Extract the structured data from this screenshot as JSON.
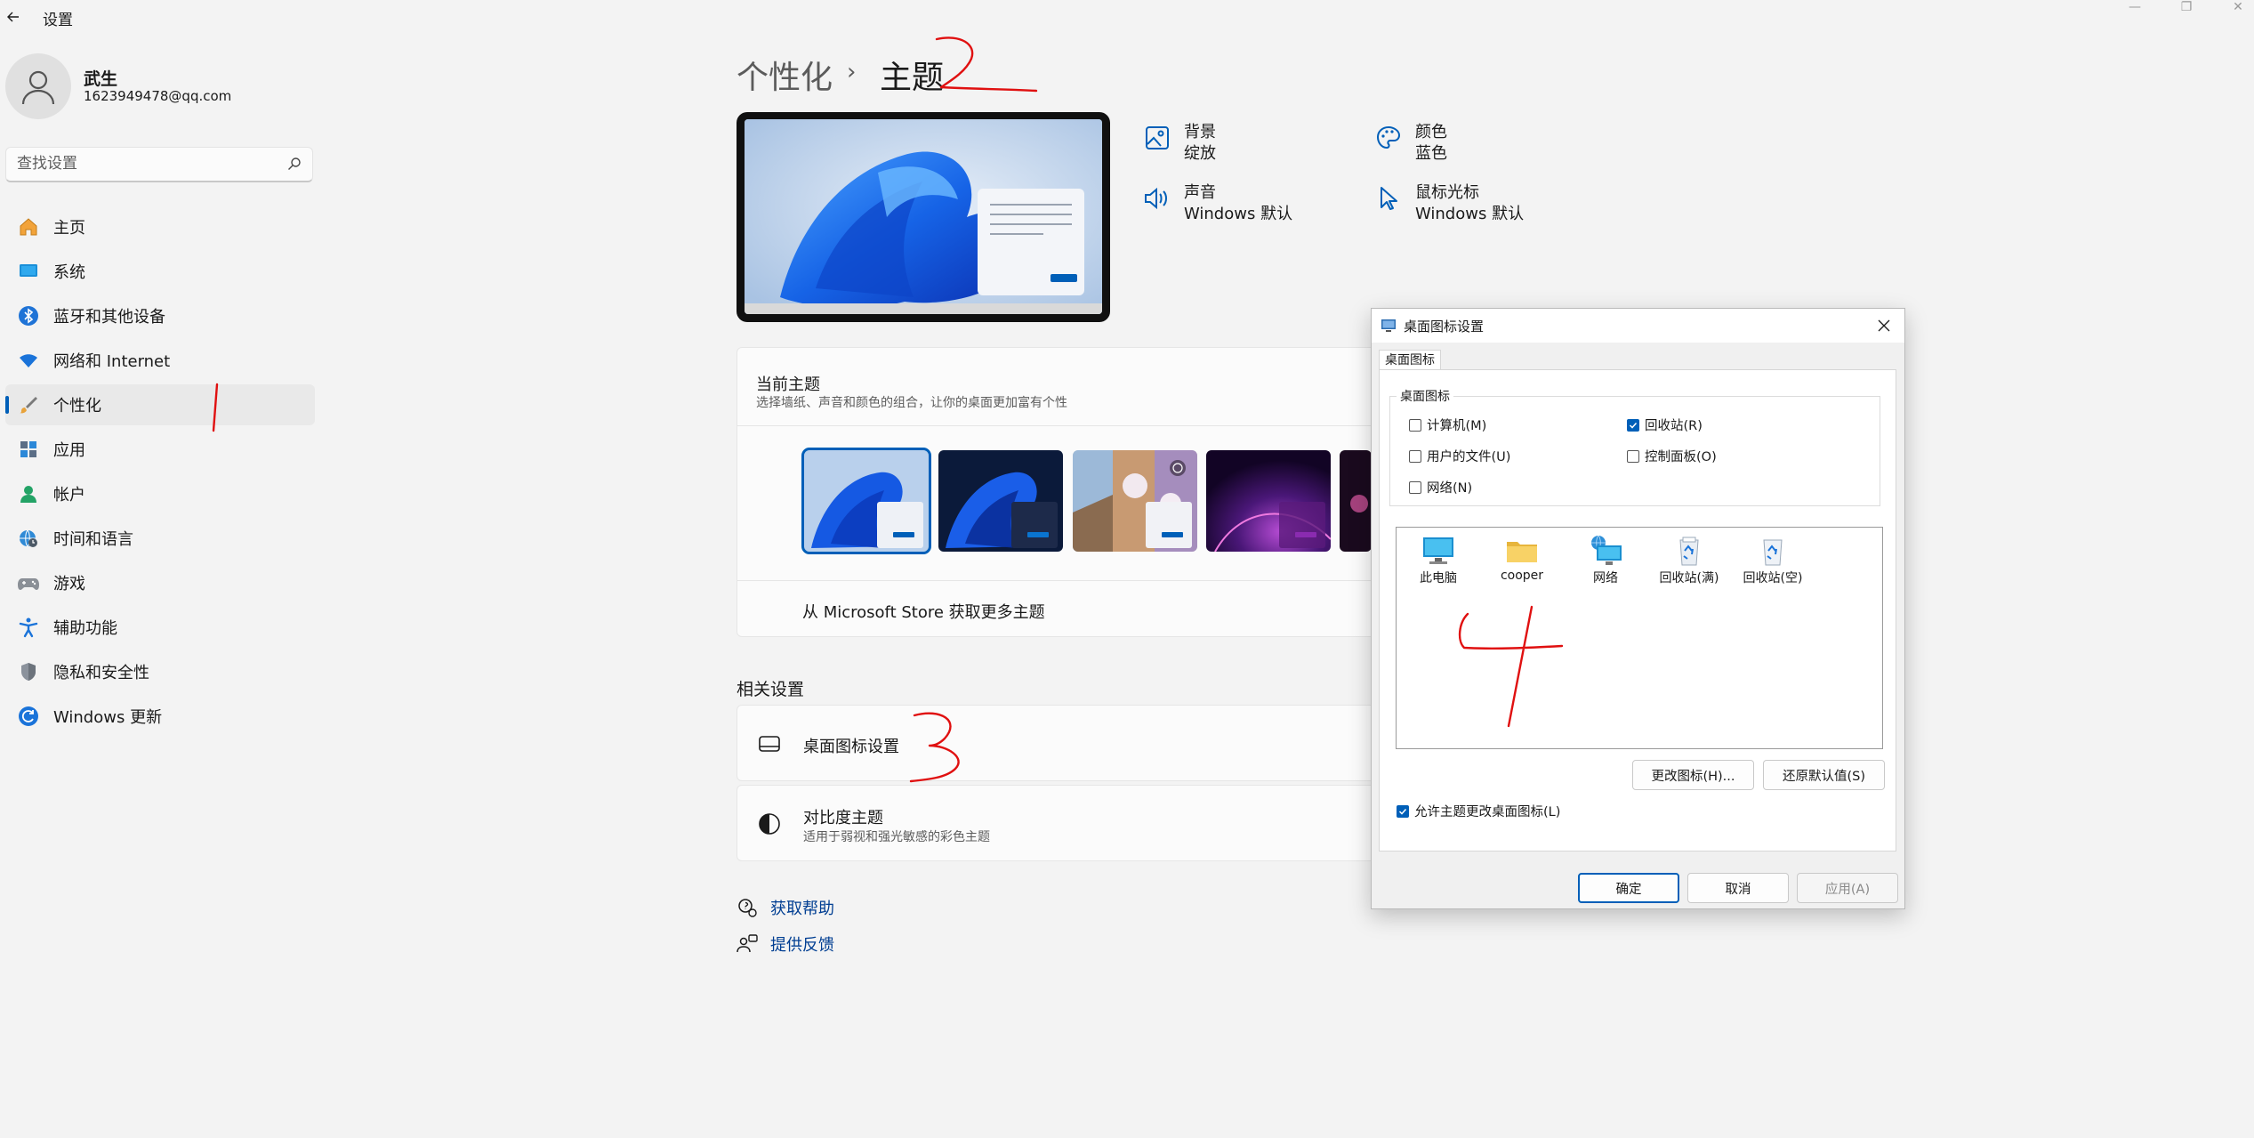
{
  "window": {
    "title": "设置",
    "minimize_glyph": "—",
    "maximize_glyph": "❐",
    "close_glyph": "✕"
  },
  "user": {
    "name": "武生",
    "email": "1623949478@qq.com"
  },
  "search": {
    "placeholder": "查找设置"
  },
  "sidebar": {
    "items": [
      {
        "label": "主页",
        "icon": "home-icon"
      },
      {
        "label": "系统",
        "icon": "monitor-icon"
      },
      {
        "label": "蓝牙和其他设备",
        "icon": "bluetooth-icon"
      },
      {
        "label": "网络和 Internet",
        "icon": "wifi-icon"
      },
      {
        "label": "个性化",
        "icon": "brush-icon",
        "active": true
      },
      {
        "label": "应用",
        "icon": "apps-icon"
      },
      {
        "label": "帐户",
        "icon": "person-icon"
      },
      {
        "label": "时间和语言",
        "icon": "globe-clock-icon"
      },
      {
        "label": "游戏",
        "icon": "gamepad-icon"
      },
      {
        "label": "辅助功能",
        "icon": "accessibility-icon"
      },
      {
        "label": "隐私和安全性",
        "icon": "shield-icon"
      },
      {
        "label": "Windows 更新",
        "icon": "update-icon"
      }
    ]
  },
  "breadcrumb": {
    "parent": "个性化",
    "separator": "›",
    "current": "主题"
  },
  "theme_props": {
    "background": {
      "title": "背景",
      "value": "绽放"
    },
    "color": {
      "title": "颜色",
      "value": "蓝色"
    },
    "sound": {
      "title": "声音",
      "value": "Windows 默认"
    },
    "cursor": {
      "title": "鼠标光标",
      "value": "Windows 默认"
    }
  },
  "current_theme": {
    "title": "当前主题",
    "description": "选择墙纸、声音和颜色的组合，让你的桌面更加富有个性",
    "store_link": "从 Microsoft Store 获取更多主题"
  },
  "related": {
    "title": "相关设置",
    "desktop_icons": "桌面图标设置",
    "contrast_title": "对比度主题",
    "contrast_desc": "适用于弱视和强光敏感的彩色主题"
  },
  "help": {
    "get_help": "获取帮助",
    "feedback": "提供反馈"
  },
  "dialog": {
    "title": "桌面图标设置",
    "tab": "桌面图标",
    "group_label": "桌面图标",
    "checkboxes": [
      {
        "label": "计算机(M)",
        "checked": false
      },
      {
        "label": "回收站(R)",
        "checked": true
      },
      {
        "label": "用户的文件(U)",
        "checked": false
      },
      {
        "label": "控制面板(O)",
        "checked": false
      },
      {
        "label": "网络(N)",
        "checked": false
      }
    ],
    "icons": [
      {
        "label": "此电脑",
        "icon": "computer-icon"
      },
      {
        "label": "cooper",
        "icon": "folder-icon"
      },
      {
        "label": "网络",
        "icon": "network-icon"
      },
      {
        "label": "回收站(满)",
        "icon": "recycle-bin-full-icon"
      },
      {
        "label": "回收站(空)",
        "icon": "recycle-bin-empty-icon"
      }
    ],
    "change_icon": "更改图标(H)...",
    "restore_default": "还原默认值(S)",
    "allow_themes": "允许主题更改桌面图标(L)",
    "allow_themes_checked": true,
    "ok": "确定",
    "cancel": "取消",
    "apply": "应用(A)"
  },
  "colors": {
    "accent": "#005fb8",
    "link": "#003e92",
    "annotation_red": "#e01010"
  }
}
